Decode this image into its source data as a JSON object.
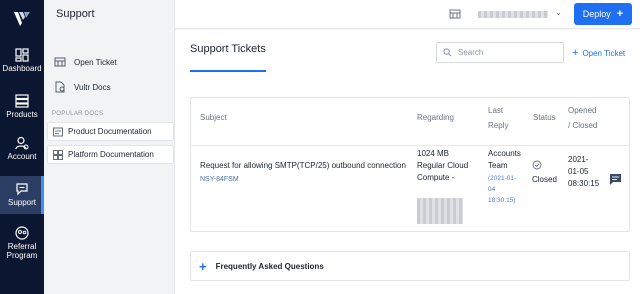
{
  "nav": {
    "items": [
      {
        "label": "Dashboard",
        "icon": "dashboard-icon"
      },
      {
        "label": "Products",
        "icon": "products-icon"
      },
      {
        "label": "Account",
        "icon": "account-icon"
      },
      {
        "label": "Support",
        "icon": "support-icon",
        "active": true
      },
      {
        "label": "Referral Program",
        "icon": "referral-icon"
      }
    ]
  },
  "sidebar": {
    "title": "Support",
    "links": [
      {
        "label": "Open Ticket",
        "icon": "ticket-icon"
      },
      {
        "label": "Vultr Docs",
        "icon": "docs-icon"
      }
    ],
    "section_label": "POPULAR DOCS",
    "docs": [
      {
        "label": "Product Documentation",
        "icon": "product-doc-icon"
      },
      {
        "label": "Platform Documentation",
        "icon": "platform-doc-icon"
      }
    ]
  },
  "topbar": {
    "deploy_label": "Deploy",
    "deploy_plus": "+",
    "caret": "⌄"
  },
  "main": {
    "title": "Support Tickets",
    "search_placeholder": "Search",
    "open_ticket_label": "Open Ticket",
    "plus": "+",
    "table": {
      "headers": {
        "subject": "Subject",
        "regarding": "Regarding",
        "last_reply_1": "Last",
        "last_reply_2": "Reply",
        "status": "Status",
        "opened_1": "Opened",
        "opened_2": "/ Closed"
      },
      "row": {
        "subject": "Request for allowing SMTP(TCP/25) outbound connection",
        "ticket_id": "NSY-84FSM",
        "regarding_1": "1024 MB",
        "regarding_2": "Regular Cloud",
        "regarding_3": "Compute -",
        "reply_1": "Accounts",
        "reply_2": "Team",
        "reply_date_1": "(2021-01-",
        "reply_date_2": "04",
        "reply_date_3": "18:30:15)",
        "status": "Closed",
        "opened_1": "2021-",
        "opened_2": "01-05",
        "opened_3": "08:30:15"
      }
    },
    "faq_label": "Frequently Asked Questions"
  },
  "colors": {
    "nav_bg": "#0b1630",
    "accent": "#1e6ff1",
    "active_nav": "#2b3d63"
  }
}
